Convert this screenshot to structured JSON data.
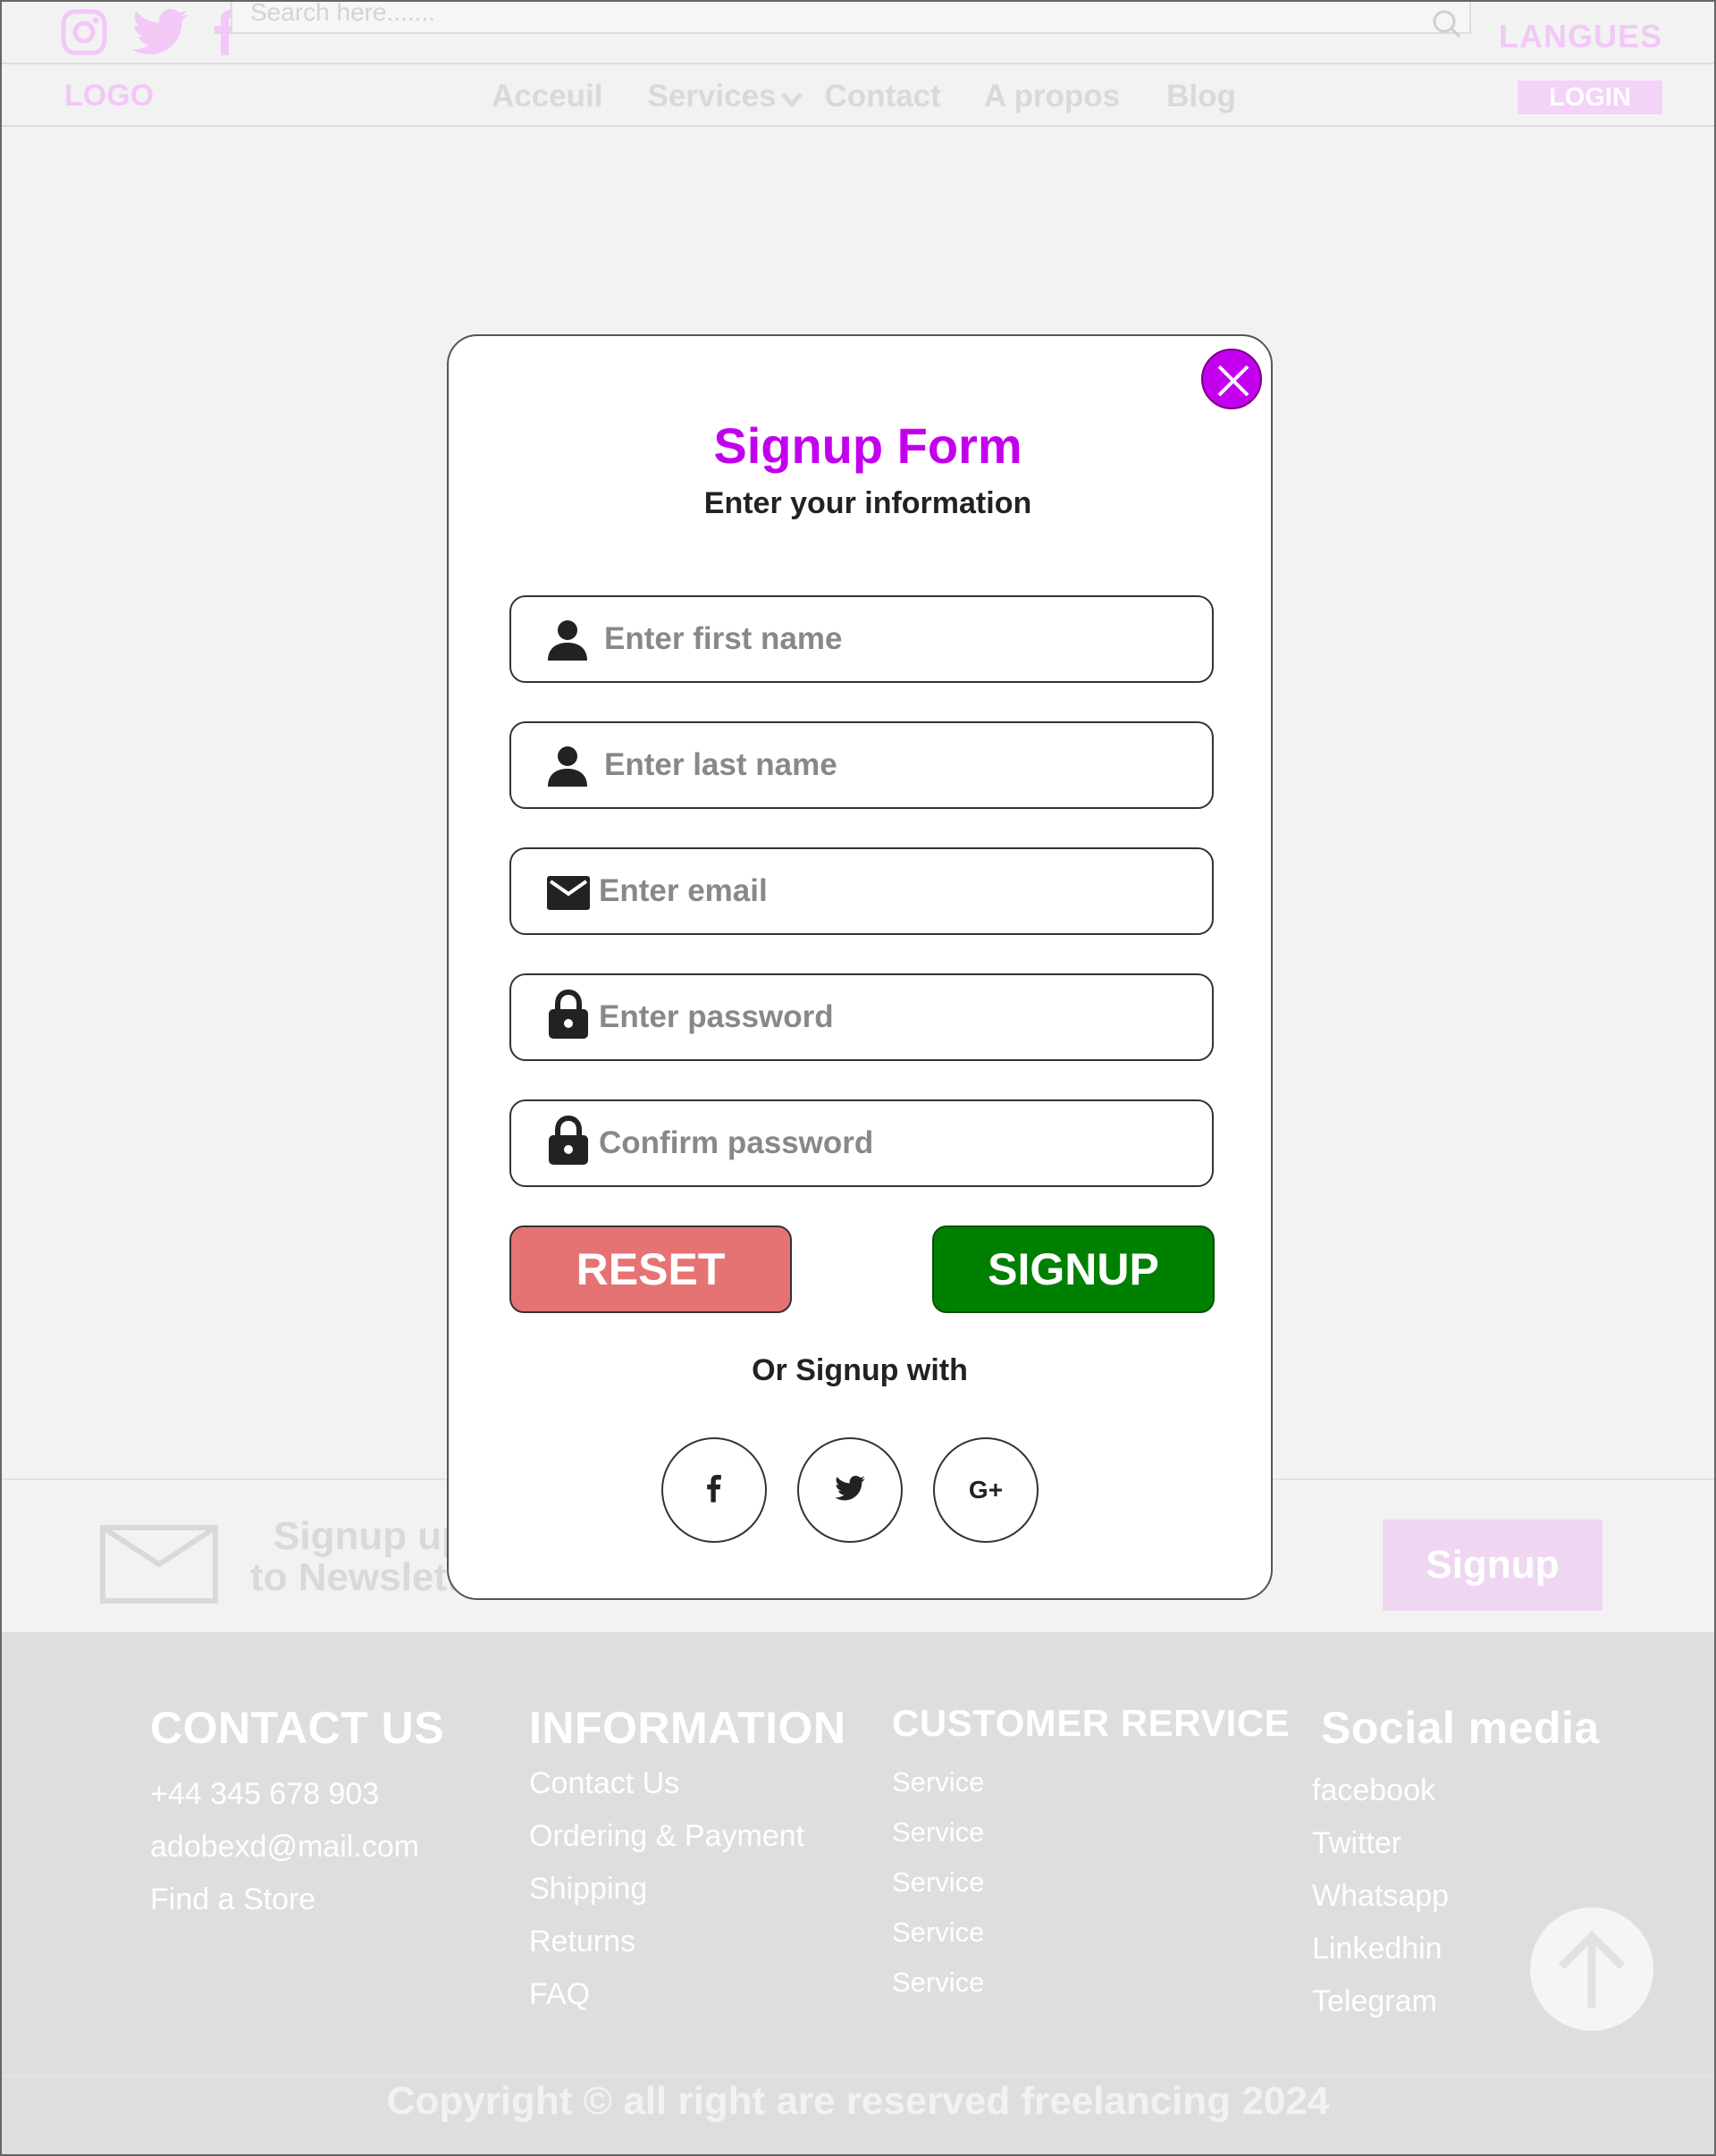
{
  "header": {
    "search_placeholder": "Search here.......",
    "languages": "LANGUES",
    "social_icons": [
      "instagram-icon",
      "twitter-icon",
      "facebook-icon"
    ]
  },
  "nav": {
    "logo": "LOGO",
    "links": [
      "Acceuil",
      "Services",
      "Contact",
      "A propos",
      "Blog"
    ],
    "login": "LOGIN"
  },
  "modal": {
    "title": "Signup Form",
    "subtitle": "Enter your information",
    "fields": [
      {
        "placeholder": "Enter first name",
        "icon": "user-icon"
      },
      {
        "placeholder": "Enter last name",
        "icon": "user-icon"
      },
      {
        "placeholder": "Enter email",
        "icon": "envelope-icon"
      },
      {
        "placeholder": "Enter password",
        "icon": "lock-icon"
      },
      {
        "placeholder": "Confirm password",
        "icon": "lock-icon"
      }
    ],
    "reset_label": "RESET",
    "signup_label": "SIGNUP",
    "or_text": "Or Signup with",
    "social_buttons": [
      "facebook-icon",
      "twitter-icon",
      "google-plus-icon"
    ],
    "google_plus_glyph": "G+"
  },
  "newsletter": {
    "line1": "Signup up",
    "line2": "to Newslett",
    "button": "Signup"
  },
  "footer": {
    "contact": {
      "heading": "CONTACT US",
      "items": [
        "+44 345 678 903",
        "adobexd@mail.com",
        "Find a Store"
      ]
    },
    "information": {
      "heading": "INFORMATION",
      "items": [
        "Contact Us",
        "Ordering & Payment",
        "Shipping",
        "Returns",
        "FAQ"
      ]
    },
    "customer": {
      "heading": "CUSTOMER RERVICE",
      "items": [
        "Service",
        "Service",
        "Service",
        "Service",
        "Service"
      ]
    },
    "social": {
      "heading": "Social media",
      "items": [
        "facebook",
        "Twitter",
        "Whatsapp",
        "Linkedhin",
        "Telegram"
      ]
    },
    "copyright": "Copyright © all right are reserved freelancing 2024"
  },
  "colors": {
    "accent": "#c300ee",
    "reset": "#e57373",
    "signup": "#008000",
    "faded_pink": "#f2c8f7"
  }
}
